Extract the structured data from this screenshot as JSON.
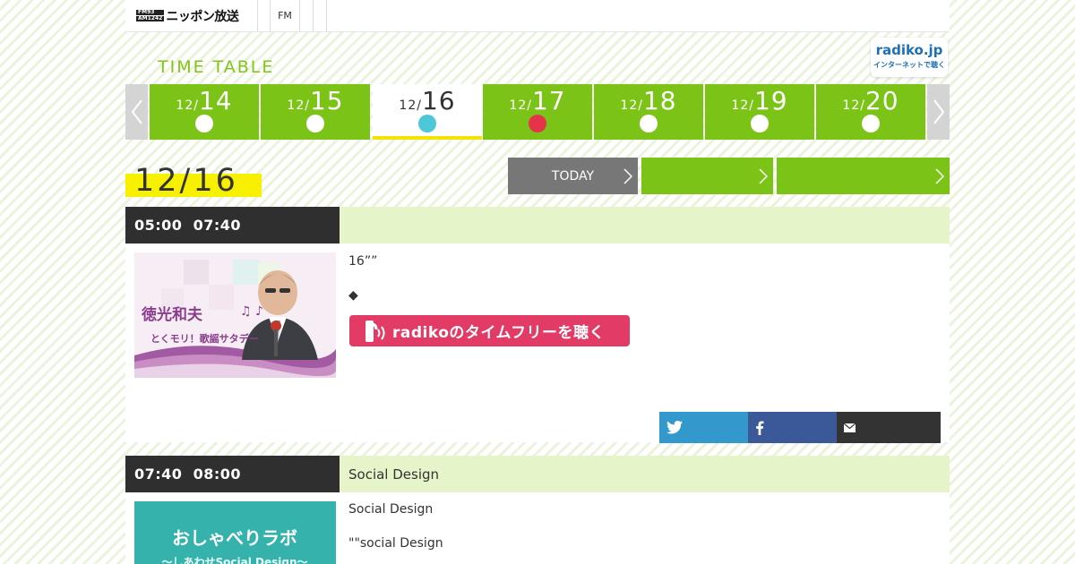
{
  "header": {
    "logo_badge_top": "FM93",
    "logo_badge_bottom": "AM1242",
    "logo_text": "ニッポン放送",
    "nav_fm": "FM"
  },
  "timetable": {
    "title": "TIME TABLE",
    "radiko_logo": "radiko.jp",
    "radiko_sub": "インターネットで聴く"
  },
  "days": [
    {
      "month": "12/",
      "day": "14",
      "dot_color": "#ffffff",
      "active": false
    },
    {
      "month": "12/",
      "day": "15",
      "dot_color": "#ffffff",
      "active": false
    },
    {
      "month": "12/",
      "day": "16",
      "dot_color": "#4ec8d8",
      "active": true
    },
    {
      "month": "12/",
      "day": "17",
      "dot_color": "#e5344a",
      "active": false
    },
    {
      "month": "12/",
      "day": "18",
      "dot_color": "#ffffff",
      "active": false
    },
    {
      "month": "12/",
      "day": "19",
      "dot_color": "#ffffff",
      "active": false
    },
    {
      "month": "12/",
      "day": "20",
      "dot_color": "#ffffff",
      "active": false
    }
  ],
  "date_heading": "12/16",
  "buttons": {
    "today": "TODAY",
    "next1": "",
    "next2": ""
  },
  "programs": [
    {
      "start": "05:00",
      "end": "07:40",
      "title": "",
      "desc_line1": "16””",
      "desc_line2": "◆",
      "thumb_text_1": "徳光和夫",
      "thumb_text_2": "とくモリ！歌謡サタデー",
      "radiko_button": "radikoのタイムフリーを聴く"
    },
    {
      "start": "07:40",
      "end": "08:00",
      "title": "Social Design",
      "desc_line1": "Social Design",
      "desc_line2": "\"\"social Design",
      "thumb_text_1": "おしゃべりラボ",
      "thumb_text_2": "〜しあわせSocial Design〜"
    }
  ],
  "colors": {
    "accent_green": "#7bc417",
    "highlight_yellow": "#f7f000",
    "radiko_pink": "#e23b66",
    "twitter": "#3399cc",
    "facebook": "#3b5998"
  }
}
